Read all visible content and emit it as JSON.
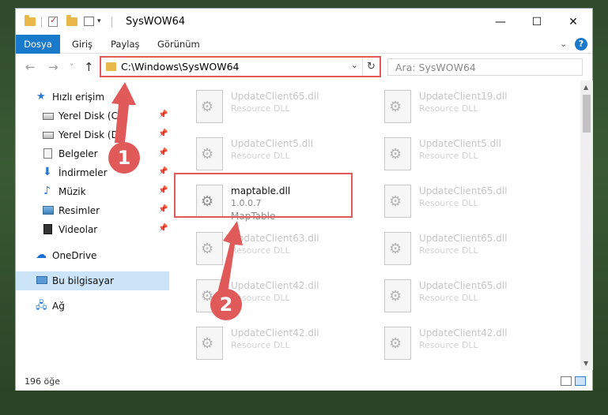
{
  "window": {
    "title": "SysWOW64",
    "controls": {
      "minimize": "—",
      "maximize": "☐",
      "close": "✕"
    }
  },
  "ribbon": {
    "tabs": [
      "Dosya",
      "Giriş",
      "Paylaş",
      "Görünüm"
    ],
    "expand_icon": "chevron-down-icon",
    "help_icon": "?"
  },
  "nav": {
    "back": "←",
    "forward": "→",
    "recent": "˅",
    "up": "↑",
    "address": "C:\\Windows\\SysWOW64",
    "search_placeholder": "Ara: SysWOW64"
  },
  "sidebar": {
    "items": [
      {
        "label": "Hızlı erişim",
        "icon": "star-icon",
        "pinned": false
      },
      {
        "label": "Yerel Disk (C:)",
        "icon": "drive-icon",
        "pinned": true
      },
      {
        "label": "Yerel Disk (D:)",
        "icon": "drive-icon",
        "pinned": true
      },
      {
        "label": "Belgeler",
        "icon": "document-icon",
        "pinned": true
      },
      {
        "label": "İndirmeler",
        "icon": "download-icon",
        "pinned": true
      },
      {
        "label": "Müzik",
        "icon": "music-icon",
        "pinned": true
      },
      {
        "label": "Resimler",
        "icon": "pictures-icon",
        "pinned": true
      },
      {
        "label": "Videolar",
        "icon": "video-icon",
        "pinned": true
      },
      {
        "label": "OneDrive",
        "icon": "cloud-icon",
        "pinned": false
      },
      {
        "label": "Bu bilgisayar",
        "icon": "computer-icon",
        "pinned": false,
        "selected": true
      },
      {
        "label": "Ağ",
        "icon": "network-icon",
        "pinned": false
      }
    ]
  },
  "files": [
    {
      "name": "UpdateClient65.dll",
      "desc": "Resource DLL"
    },
    {
      "name": "UpdateClient19.dll",
      "desc": "Resource DLL"
    },
    {
      "name": "UpdateClient5.dll",
      "desc": "Resource DLL"
    },
    {
      "name": "UpdateClient5.dll",
      "desc": "Resource DLL"
    },
    {
      "name": "maptable.dll",
      "desc": "1.0.0.7",
      "desc2": "MapTable",
      "highlighted": true
    },
    {
      "name": "UpdateClient65.dll",
      "desc": "Resource DLL"
    },
    {
      "name": "UpdateClient63.dll",
      "desc": "Resource DLL"
    },
    {
      "name": "UpdateClient65.dll",
      "desc": "Resource DLL"
    },
    {
      "name": "UpdateClient42.dll",
      "desc": "Resource DLL"
    },
    {
      "name": "UpdateClient65.dll",
      "desc": "Resource DLL"
    },
    {
      "name": "UpdateClient42.dll",
      "desc": "Resource DLL"
    },
    {
      "name": "UpdateClient42.dll",
      "desc": "Resource DLL"
    }
  ],
  "status": {
    "count": "196 öğe"
  },
  "annotations": {
    "step1": "1",
    "step2": "2",
    "color": "#e05a5a"
  }
}
